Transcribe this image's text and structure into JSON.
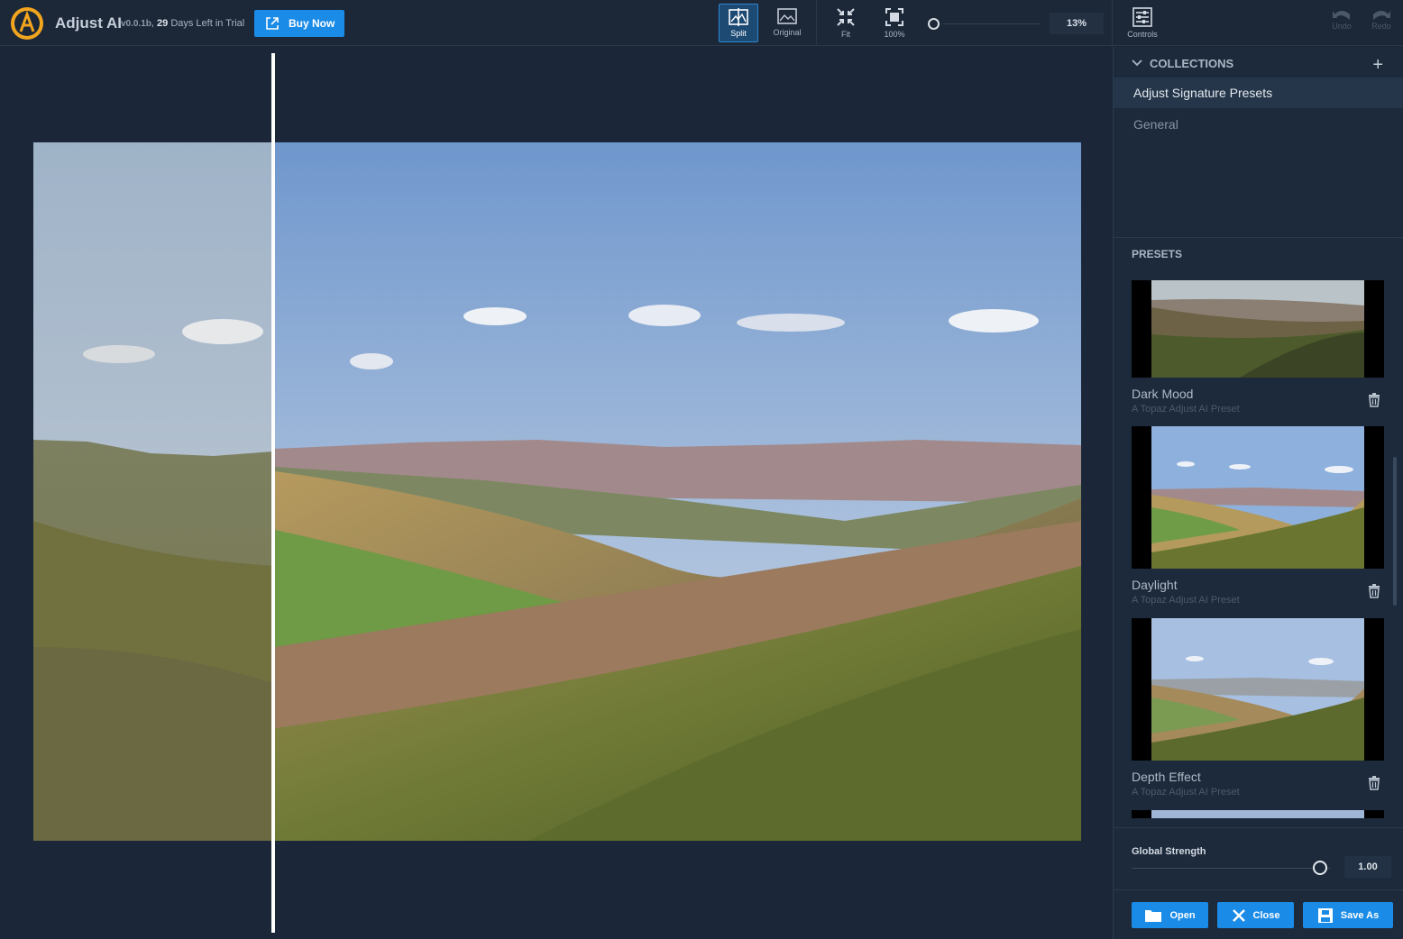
{
  "app": {
    "title": "Adjust AI",
    "version": "v0.0.1b,",
    "trial_days": "29",
    "trial_text": "Days Left in Trial",
    "buy_label": "Buy Now",
    "logo_icon": "topaz-a-logo"
  },
  "toolbar": {
    "split_label": "Split",
    "original_label": "Original",
    "fit_label": "Fit",
    "hundred_label": "100%",
    "zoom_value": "13%",
    "controls_label": "Controls",
    "undo_label": "Undo",
    "redo_label": "Redo"
  },
  "collections": {
    "header": "COLLECTIONS",
    "items": [
      {
        "label": "Adjust Signature Presets"
      },
      {
        "label": "General"
      }
    ]
  },
  "presets": {
    "header": "PRESETS",
    "items": [
      {
        "name": "Dark Mood",
        "subtitle": "A Topaz Adjust AI Preset"
      },
      {
        "name": "Daylight",
        "subtitle": "A Topaz Adjust AI Preset"
      },
      {
        "name": "Depth Effect",
        "subtitle": "A Topaz Adjust AI Preset"
      }
    ]
  },
  "strength": {
    "label": "Global Strength",
    "value": "1.00",
    "fraction": 0.95
  },
  "actions": {
    "open_label": "Open",
    "close_label": "Close",
    "save_label": "Save As"
  },
  "colors": {
    "accent": "#1a8be6",
    "background": "#1b2738",
    "panel": "#1d2a3b"
  }
}
